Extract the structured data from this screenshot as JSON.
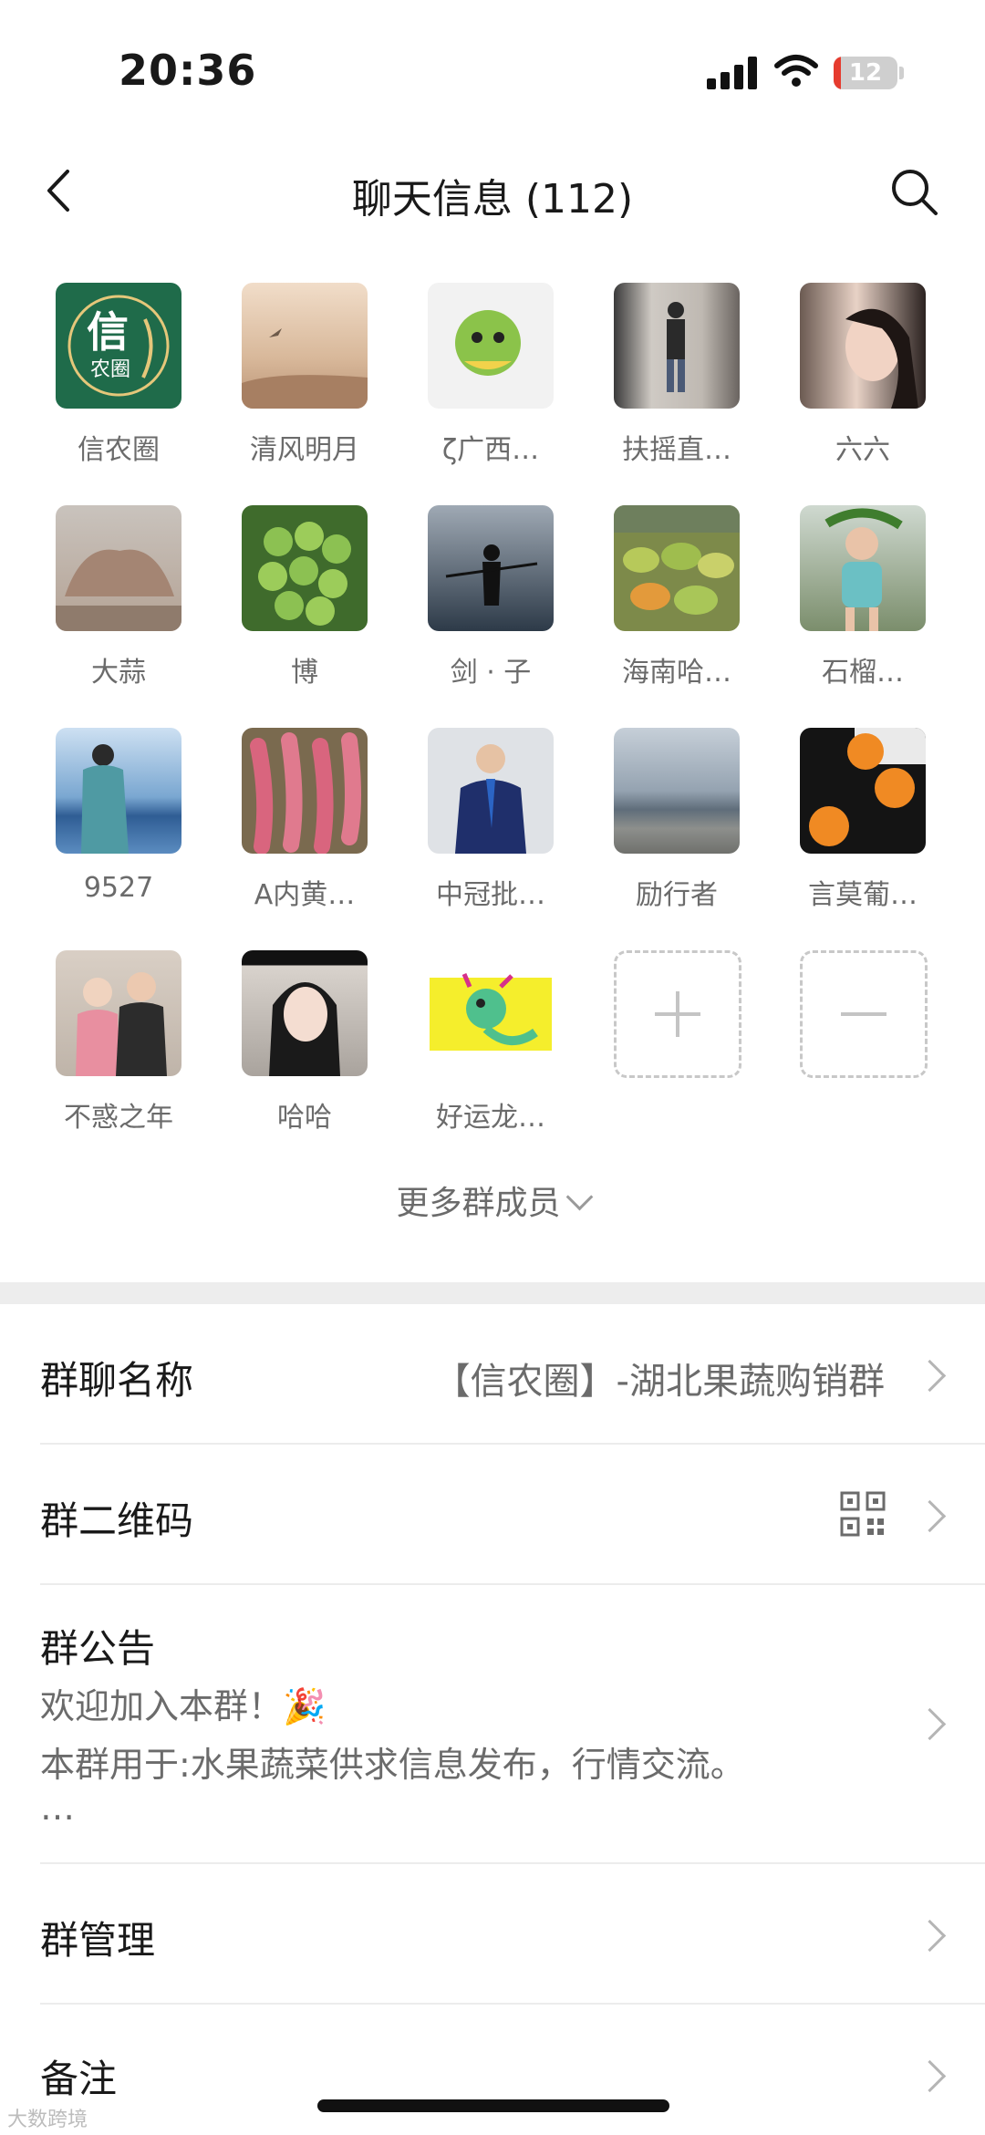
{
  "status_bar": {
    "time": "20:36",
    "battery": "12",
    "battery_level": 0.12
  },
  "nav": {
    "title": "聊天信息 (112)"
  },
  "members": [
    {
      "name": "信农圈"
    },
    {
      "name": "清风明月"
    },
    {
      "name": "ζ广西…"
    },
    {
      "name": "扶摇直…"
    },
    {
      "name": "六六"
    },
    {
      "name": "大蒜"
    },
    {
      "name": "博"
    },
    {
      "name": "剑 · 子"
    },
    {
      "name": "海南哈…"
    },
    {
      "name": "石榴…"
    },
    {
      "name": "9527"
    },
    {
      "name": "A内黄…"
    },
    {
      "name": "中冠批…"
    },
    {
      "name": "励行者"
    },
    {
      "name": "言莫葡…"
    },
    {
      "name": "不惑之年"
    },
    {
      "name": "哈哈"
    },
    {
      "name": "好运龙…"
    }
  ],
  "avatar_logo": {
    "main": "信",
    "sub": "农圈"
  },
  "more_members": "更多群成员",
  "settings": {
    "group_name_label": "群聊名称",
    "group_name_value": "【信农圈】-湖北果蔬购销群",
    "qr_label": "群二维码",
    "notice_label": "群公告",
    "notice_line1": "欢迎加入本群！🎉",
    "notice_line2": "本群用于:水果蔬菜供求信息发布，行情交流。",
    "notice_line3": "…",
    "manage_label": "群管理",
    "remark_label": "备注"
  },
  "watermark": "大数跨境",
  "colors": {
    "logo_green": "#1f6b4a",
    "battery_red": "#e63b2e"
  }
}
